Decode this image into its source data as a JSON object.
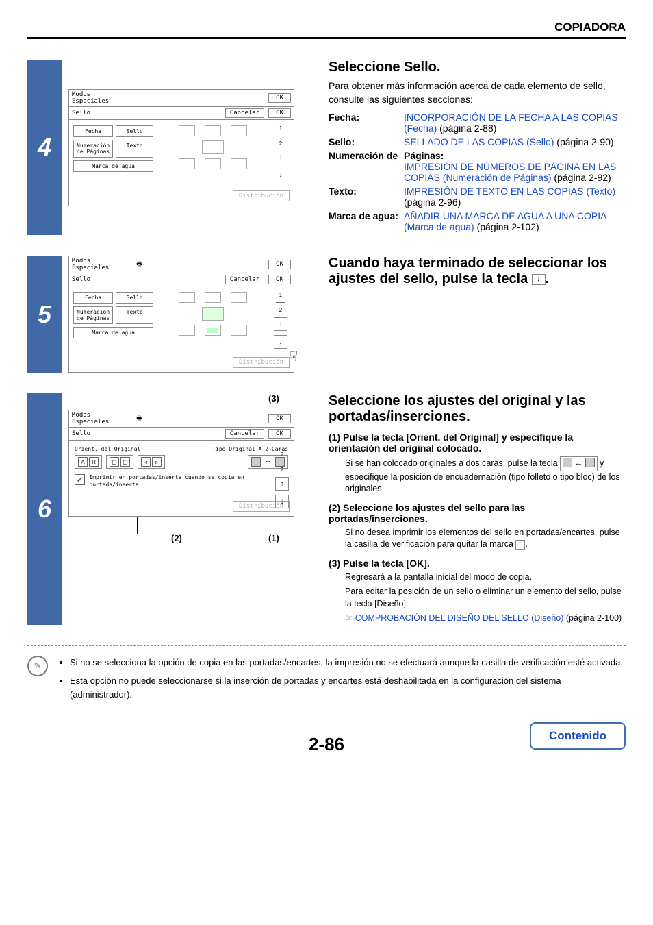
{
  "header": "COPIADORA",
  "page_number": "2-86",
  "contenido": "Contenido",
  "step4": {
    "num": "4",
    "ui": {
      "title": "Modos\nEspeciales",
      "ok": "OK",
      "sub_label": "Sello",
      "cancel": "Cancelar",
      "btn_fecha": "Fecha",
      "btn_sello": "Sello",
      "btn_num": "Numeración\nde Páginas",
      "btn_texto": "Texto",
      "btn_marca": "Marca de agua",
      "dist": "Distribución",
      "pg_top": "1",
      "pg_bot": "2"
    },
    "heading": "Seleccione Sello.",
    "intro": "Para obtener más información acerca de cada elemento de sello, consulte las siguientes secciones:",
    "defs": [
      {
        "term": "Fecha:",
        "link": "INCORPORACIÓN DE LA FECHA A LAS COPIAS (Fecha)",
        "tail": " (página 2-88)"
      },
      {
        "term": "Sello:",
        "link": "SELLADO DE LAS COPIAS (Sello)",
        "tail": " (página 2-90)"
      },
      {
        "term": "Numeración de",
        "cont": "Páginas:",
        "link": "IMPRESIÓN DE NÚMEROS DE PÁGINA EN LAS COPIAS (Numeración de Páginas)",
        "tail": " (página 2-92)"
      },
      {
        "term": "Texto:",
        "link": "IMPRESIÓN DE TEXTO EN LAS COPIAS (Texto)",
        "tail": " (página 2-96)"
      },
      {
        "term": "Marca de agua",
        "post": ":",
        "link": "AÑADIR UNA MARCA DE AGUA A UNA COPIA (Marca de agua)",
        "tail": " (página 2-102)"
      }
    ]
  },
  "step5": {
    "num": "5",
    "ui": {
      "title": "Modos\nEspeciales",
      "ok": "OK",
      "sub_label": "Sello",
      "cancel": "Cancelar",
      "btn_fecha": "Fecha",
      "btn_sello": "Sello",
      "btn_num": "Numeración\nde Páginas",
      "btn_texto": "Texto",
      "btn_marca": "Marca de agua",
      "dist": "Distribución",
      "pg_top": "1",
      "pg_bot": "2"
    },
    "heading_a": "Cuando haya terminado de seleccionar los ajustes del sello, pulse la tecla ",
    "heading_b": "."
  },
  "step6": {
    "num": "6",
    "callouts": {
      "c1": "(1)",
      "c2": "(2)",
      "c3": "(3)"
    },
    "ui": {
      "title": "Modos\nEspeciales",
      "ok": "OK",
      "sub_label": "Sello",
      "cancel": "Cancelar",
      "orient_label": "Orient. del Original",
      "tipo_label": "Tipo Original A 2-Caras",
      "check_text": "Imprimir en portadas/inserta cuando se copia en portada/inserta",
      "dist": "Distribución",
      "pg_top": "2",
      "pg_bot": "2"
    },
    "heading": "Seleccione los ajustes del original y las portadas/inserciones.",
    "ss1_h": "(1) Pulse la tecla [Orient. del Original] y especifique la orientación del original colocado.",
    "ss1_p1": "Si se han colocado originales a dos caras, pulse la tecla ",
    "ss1_p2": " y especifique la posición de encuadernación (tipo folleto o tipo bloc) de los originales.",
    "ss2_h": "(2) Seleccione los ajustes del sello para las portadas/inserciones.",
    "ss2_p": "Si no desea imprimir los elementos del sello en portadas/encartes, pulse la casilla de verificación para quitar la marca ",
    "ss2_tail": ".",
    "ss3_h": "(3) Pulse la tecla [OK].",
    "ss3_p1": "Regresará a la pantalla inicial del modo de copia.",
    "ss3_p2": "Para editar la posición de un sello o eliminar un elemento del sello, pulse la tecla [Diseño].",
    "ss3_link": "COMPROBACIÓN DEL DISEÑO DEL SELLO (Diseño)",
    "ss3_tail": " (página 2-100)"
  },
  "notes": {
    "n1": "Si no se selecciona la opción de copia en las portadas/encartes, la impresión no se efectuará aunque la casilla de verificación esté activada.",
    "n2": "Esta opción no puede seleccionarse si la inserción de portadas y encartes está deshabilitada en la configuración del sistema (administrador)."
  }
}
